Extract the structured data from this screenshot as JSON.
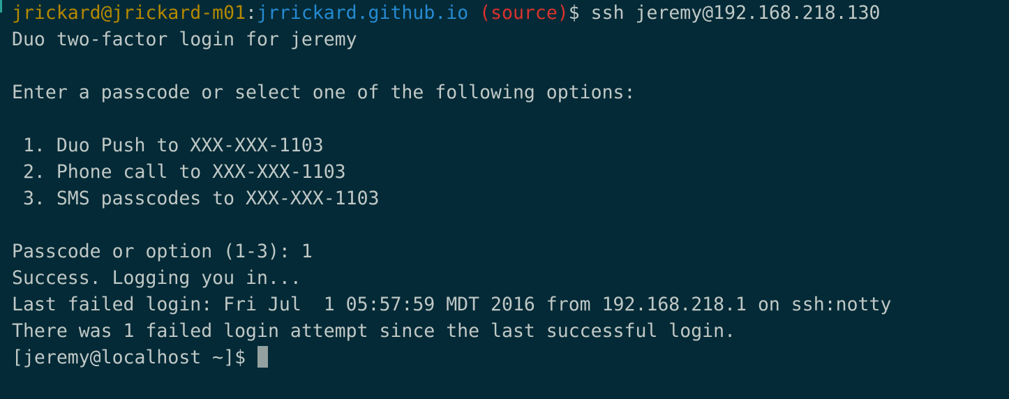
{
  "prompt": {
    "user_host": "jrickard@jrickard-m01",
    "separator": ":",
    "directory": "jrrickard.github.io",
    "branch": " (source)",
    "dollar": "$ ",
    "command": "ssh jeremy@192.168.218.130"
  },
  "output_lines": [
    "Duo two-factor login for jeremy",
    "",
    "Enter a passcode or select one of the following options:",
    "",
    " 1. Duo Push to XXX-XXX-1103",
    " 2. Phone call to XXX-XXX-1103",
    " 3. SMS passcodes to XXX-XXX-1103",
    "",
    "Passcode or option (1-3): 1",
    "Success. Logging you in...",
    "Last failed login: Fri Jul  1 05:57:59 MDT 2016 from 192.168.218.1 on ssh:notty",
    "There was 1 failed login attempt since the last successful login."
  ],
  "remote_prompt": "[jeremy@localhost ~]$ ",
  "colors": {
    "background": "#032a36",
    "foreground": "#c0c8c6",
    "user_host": "#b58900",
    "directory": "#268bd2",
    "branch": "#dc322f"
  }
}
